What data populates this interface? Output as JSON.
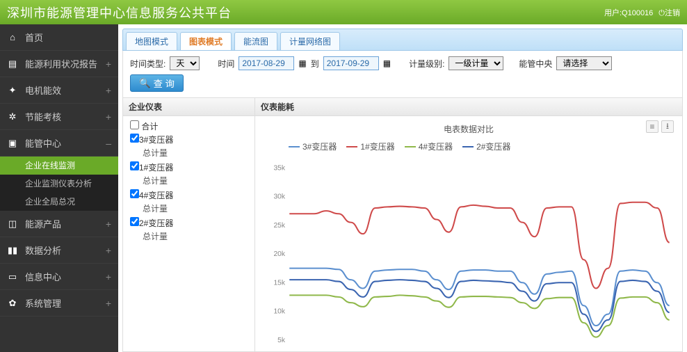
{
  "topbar": {
    "title": "深圳市能源管理中心信息服务公共平台",
    "user_prefix": "用户:",
    "user_id": "Q100016",
    "logout": "注销"
  },
  "sidebar": {
    "items": [
      {
        "icon": "home",
        "label": "首页",
        "expand": ""
      },
      {
        "icon": "file",
        "label": "能源利用状况报告",
        "expand": "+"
      },
      {
        "icon": "bolt",
        "label": "电机能效",
        "expand": "+"
      },
      {
        "icon": "gear",
        "label": "节能考核",
        "expand": "+"
      },
      {
        "icon": "monitor",
        "label": "能管中心",
        "expand": "–"
      },
      {
        "icon": "cube",
        "label": "能源产品",
        "expand": "+"
      },
      {
        "icon": "bars",
        "label": "数据分析",
        "expand": "+"
      },
      {
        "icon": "clip",
        "label": "信息中心",
        "expand": "+"
      },
      {
        "icon": "cog",
        "label": "系统管理",
        "expand": "+"
      }
    ],
    "sub": [
      {
        "label": "企业在线监测",
        "active": true
      },
      {
        "label": "企业监测仪表分析",
        "active": false
      },
      {
        "label": "企业全局总况",
        "active": false
      }
    ]
  },
  "tabs": {
    "items": [
      {
        "label": "地图模式",
        "active": false
      },
      {
        "label": "图表模式",
        "active": true
      },
      {
        "label": "能流图",
        "active": false
      },
      {
        "label": "计量网络图",
        "active": false
      }
    ]
  },
  "filters": {
    "time_type_label": "时间类型:",
    "time_type_value": "天",
    "time_label": "时间",
    "date_from": "2017-08-29",
    "date_to_label": "到",
    "date_to": "2017-09-29",
    "level_label": "计量级别:",
    "level_value": "一级计量",
    "central_label": "能管中央",
    "central_placeholder": "请选择",
    "query_btn": "查 询"
  },
  "tree": {
    "title": "企业仪表",
    "merge_label": "合计",
    "meters": [
      {
        "name": "3#变压器",
        "sub": "总计量"
      },
      {
        "name": "1#变压器",
        "sub": "总计量"
      },
      {
        "name": "4#变压器",
        "sub": "总计量"
      },
      {
        "name": "2#变压器",
        "sub": "总计量"
      }
    ]
  },
  "chart_panel": {
    "title": "仪表能耗",
    "subtitle": "电表数据对比"
  },
  "chart_data": {
    "type": "line",
    "title": "电表数据对比",
    "xlabel": "",
    "ylabel": "",
    "ylim": [
      5000,
      35000
    ],
    "yticks": [
      5000,
      10000,
      15000,
      20000,
      25000,
      30000,
      35000
    ],
    "ytick_labels": [
      "5k",
      "10k",
      "15k",
      "20k",
      "25k",
      "30k",
      "35k"
    ],
    "x": [
      0,
      1,
      2,
      3,
      4,
      5,
      6,
      7,
      8,
      9,
      10,
      11,
      12,
      13,
      14,
      15,
      16,
      17,
      18,
      19,
      20,
      21,
      22,
      23,
      24,
      25,
      26,
      27,
      28,
      29,
      30,
      31
    ],
    "series": [
      {
        "name": "3#变压器",
        "color": "#5b8fcf",
        "values": [
          17500,
          17500,
          17500,
          17500,
          17300,
          15500,
          14000,
          17000,
          17200,
          17300,
          17300,
          17000,
          15500,
          13800,
          17000,
          17200,
          17200,
          17000,
          17000,
          15000,
          13000,
          16500,
          16800,
          17000,
          11000,
          7500,
          9500,
          17000,
          17200,
          17000,
          15000,
          11000
        ]
      },
      {
        "name": "1#变压器",
        "color": "#cf4a4a",
        "values": [
          27000,
          27000,
          27000,
          27500,
          27000,
          25500,
          23500,
          28000,
          28200,
          28300,
          28200,
          28000,
          26000,
          23800,
          28200,
          28500,
          28300,
          28000,
          28000,
          25500,
          23000,
          28000,
          28200,
          28200,
          19000,
          14000,
          17500,
          28800,
          29000,
          29000,
          28000,
          22000
        ]
      },
      {
        "name": "4#变压器",
        "color": "#8fb84a",
        "values": [
          12800,
          12800,
          12800,
          12800,
          12500,
          11500,
          10800,
          12500,
          12600,
          12800,
          12700,
          12500,
          11800,
          10700,
          12500,
          12600,
          12600,
          12500,
          12400,
          11500,
          10500,
          12200,
          12400,
          12400,
          8000,
          5500,
          7500,
          12300,
          12500,
          12500,
          11500,
          8500
        ]
      },
      {
        "name": "2#变压器",
        "color": "#3a64b0",
        "values": [
          15500,
          15500,
          15500,
          15500,
          15200,
          13800,
          12500,
          15200,
          15400,
          15500,
          15400,
          15200,
          14000,
          12400,
          15200,
          15400,
          15300,
          15200,
          15000,
          13500,
          11800,
          14800,
          15000,
          15000,
          9500,
          6500,
          8500,
          15200,
          15400,
          15200,
          13500,
          9800
        ]
      }
    ]
  }
}
